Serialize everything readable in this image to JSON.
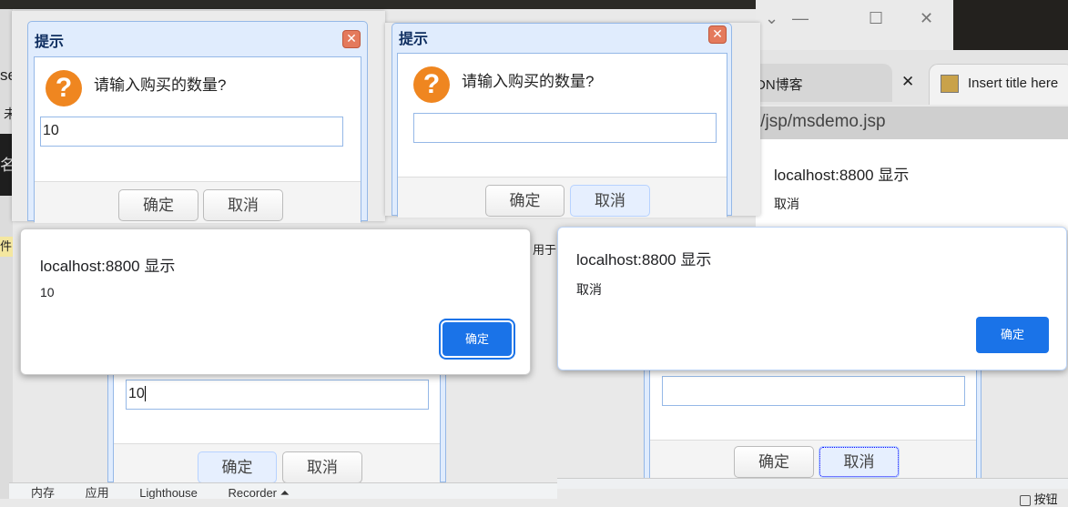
{
  "browser": {
    "tab_inactive": "DN博客",
    "tab_active": "Insert title here",
    "address": "t/jsp/msdemo.jsp",
    "page_alert_title": "localhost:8800 显示",
    "page_alert_message": "取消"
  },
  "left_fragments": {
    "a": "se,",
    "b": "未",
    "c": "名",
    "d": "件"
  },
  "middle_fragment": "用于",
  "prompt_dialog_1": {
    "title": "提示",
    "message": "请输入购买的数量?",
    "input_value": "10",
    "ok": "确定",
    "cancel": "取消"
  },
  "prompt_dialog_2": {
    "title": "提示",
    "message": "请输入购买的数量?",
    "input_value": "",
    "ok": "确定",
    "cancel": "取消"
  },
  "alert_1": {
    "title": "localhost:8800 显示",
    "message": "10",
    "ok": "确定"
  },
  "alert_2": {
    "title": "localhost:8800 显示",
    "message": "取消",
    "ok": "确定"
  },
  "bottom_dialog_1": {
    "input_value": "10",
    "ok": "确定",
    "cancel": "取消"
  },
  "bottom_dialog_2": {
    "input_value": "",
    "ok": "确定",
    "cancel": "取消"
  },
  "devtools_tabs": [
    "内存",
    "应用",
    "Lighthouse",
    "Recorder ⏶"
  ],
  "checkbox_label": "按钮",
  "colors": {
    "accent": "#1a73e8",
    "panel_border": "#95b8e7",
    "question_icon": "#ef8620"
  }
}
